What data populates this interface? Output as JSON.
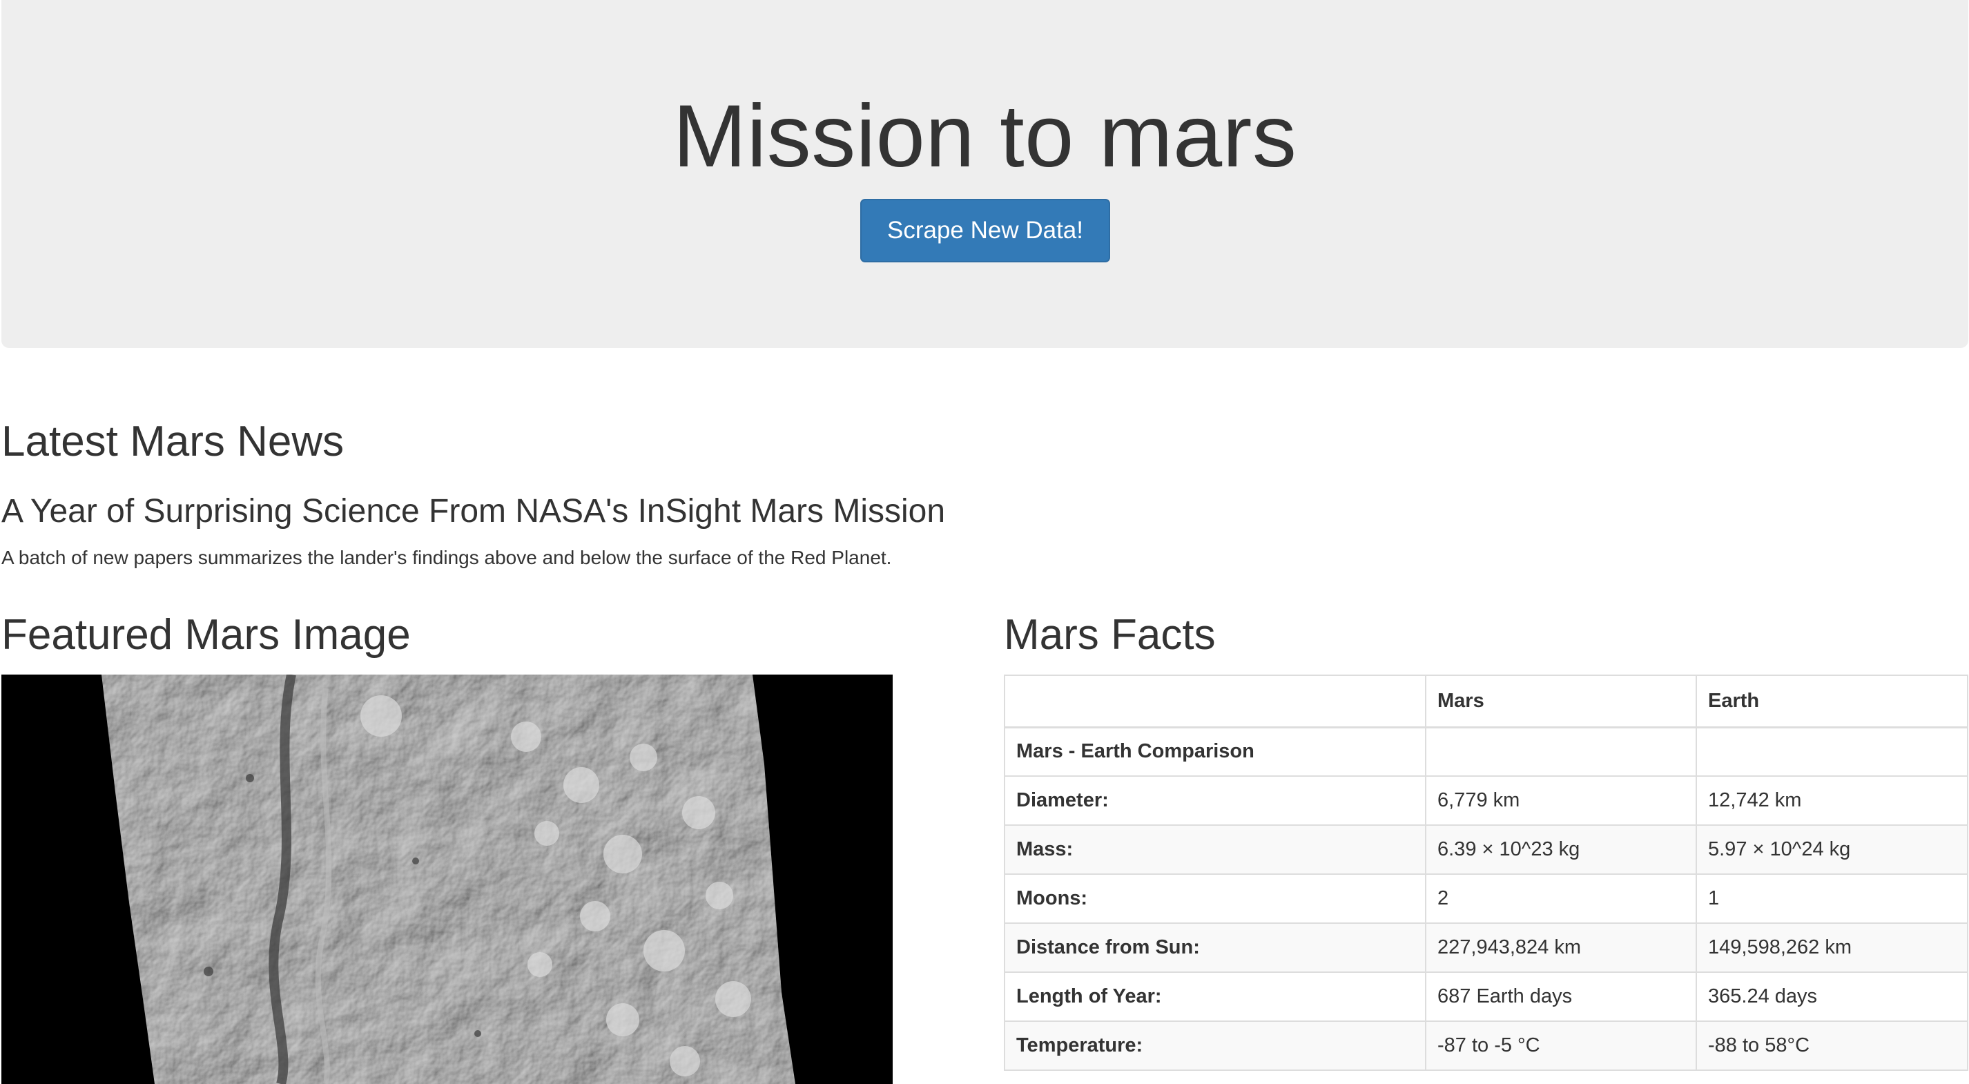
{
  "jumbotron": {
    "title": "Mission to mars",
    "button_label": "Scrape New Data!"
  },
  "news": {
    "heading": "Latest Mars News",
    "title": "A Year of Surprising Science From NASA's InSight Mars Mission",
    "teaser": "A batch of new papers summarizes the lander's findings above and below the surface of the Red Planet."
  },
  "featured_image": {
    "heading": "Featured Mars Image"
  },
  "facts": {
    "heading": "Mars Facts",
    "columns": [
      "",
      "Mars",
      "Earth"
    ],
    "rows": [
      {
        "label": "Mars - Earth Comparison",
        "mars": "",
        "earth": ""
      },
      {
        "label": "Diameter:",
        "mars": "6,779 km",
        "earth": "12,742 km"
      },
      {
        "label": "Mass:",
        "mars": "6.39 × 10^23 kg",
        "earth": "5.97 × 10^24 kg"
      },
      {
        "label": "Moons:",
        "mars": "2",
        "earth": "1"
      },
      {
        "label": "Distance from Sun:",
        "mars": "227,943,824 km",
        "earth": "149,598,262 km"
      },
      {
        "label": "Length of Year:",
        "mars": "687 Earth days",
        "earth": "365.24 days"
      },
      {
        "label": "Temperature:",
        "mars": "-87 to -5 °C",
        "earth": "-88 to 58°C"
      }
    ]
  },
  "colors": {
    "jumbotron_bg": "#eeeeee",
    "button_bg": "#337ab7",
    "text": "#333333"
  }
}
